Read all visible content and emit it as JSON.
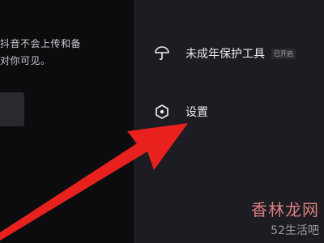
{
  "background_text": {
    "lines": [
      "抖音不会上传和备",
      "对你可见。"
    ]
  },
  "menu": {
    "items": [
      {
        "label": "未成年保护工具",
        "badge": "已开启",
        "icon": "umbrella-icon"
      },
      {
        "label": "设置",
        "icon": "hexagon-settings-icon"
      }
    ]
  },
  "annotation": {
    "arrow_color": "#e8211e",
    "arrow_icon": "red-arrow-pointing-to-settings"
  },
  "watermark": {
    "brand": "香林龙网",
    "sub": "52生活吧"
  }
}
